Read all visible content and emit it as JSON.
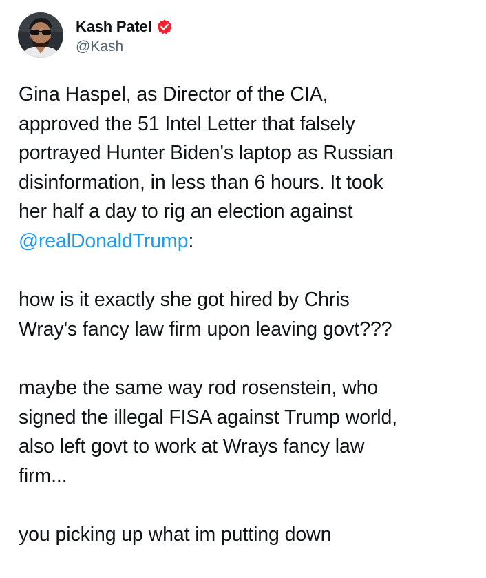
{
  "author": {
    "display_name": "Kash Patel",
    "handle": "@Kash",
    "verified": true,
    "verified_color": "#f4212e",
    "avatar_icon": "avatar-photo-icon"
  },
  "post": {
    "p1_lines": [
      "Gina Haspel, as Director of the CIA,",
      "approved the 51 Intel Letter that falsely",
      "portrayed Hunter Biden's laptop as Russian",
      "disinformation, in less than 6 hours. It took",
      "her half a day to rig an election against"
    ],
    "mention": "@realDonaldTrump",
    "mention_suffix": ":",
    "p2_lines": [
      "how is it exactly she got hired by Chris",
      "Wray's fancy law firm upon leaving govt???"
    ],
    "p3_lines": [
      "maybe the same way rod rosenstein, who",
      "signed the illegal FISA against Trump world,",
      "also left govt to work at Wrays fancy law",
      "firm..."
    ],
    "p4_lines": [
      "you picking up what im putting down"
    ]
  },
  "colors": {
    "text": "#0f1419",
    "secondary": "#536471",
    "link": "#1d9bf0"
  }
}
